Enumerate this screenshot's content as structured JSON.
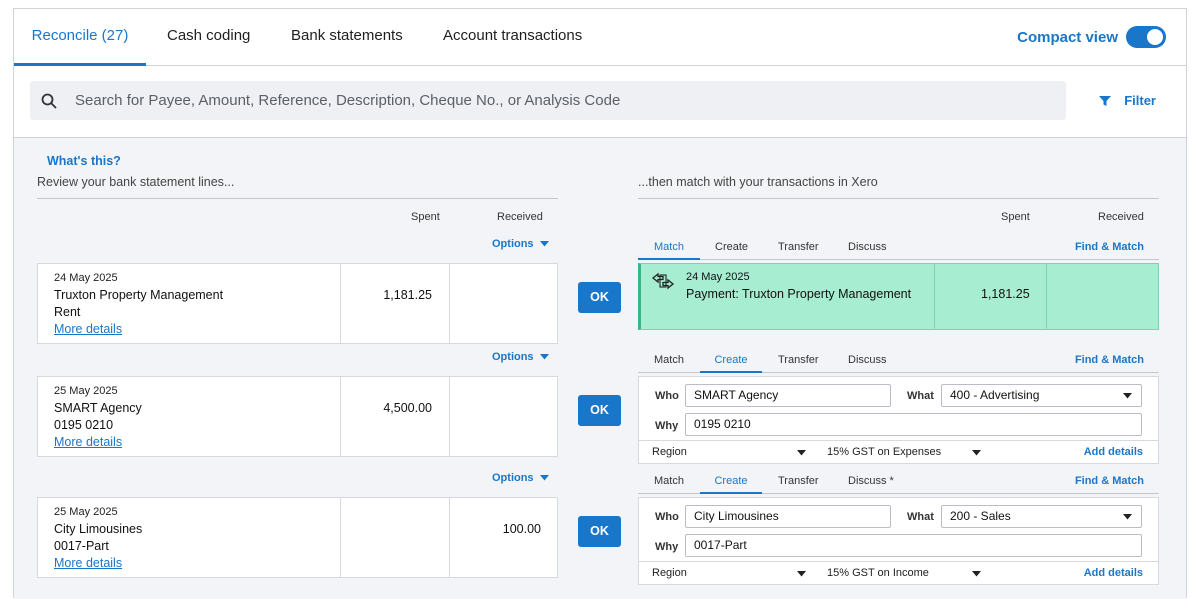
{
  "tabs": [
    {
      "label": "Reconcile (27)",
      "active": true
    },
    {
      "label": "Cash coding",
      "active": false
    },
    {
      "label": "Bank statements",
      "active": false
    },
    {
      "label": "Account transactions",
      "active": false
    }
  ],
  "compact_view": {
    "label": "Compact view",
    "enabled": true
  },
  "search": {
    "placeholder": "Search for Payee, Amount, Reference, Description, Cheque No., or Analysis Code",
    "value": ""
  },
  "filter_label": "Filter",
  "left_header": {
    "whats_this": "What's this?",
    "review": "Review your bank statement lines...",
    "spent": "Spent",
    "received": "Received"
  },
  "right_header": {
    "then": "...then match with your transactions in Xero",
    "spent": "Spent",
    "received": "Received"
  },
  "options_label": "Options",
  "ok_label": "OK",
  "more_details_label": "More details",
  "find_match_label": "Find & Match",
  "add_details_label": "Add details",
  "labels": {
    "who": "Who",
    "what": "What",
    "why": "Why",
    "region": "Region"
  },
  "right_tabs": [
    "Match",
    "Create",
    "Transfer",
    "Discuss"
  ],
  "right_tab_discuss_flagged": "Discuss *",
  "statement_lines": [
    {
      "date": "24 May 2025",
      "payee": "Truxton Property Management",
      "ref": "Rent",
      "spent": "1,181.25",
      "received": ""
    },
    {
      "date": "25 May 2025",
      "payee": "SMART Agency",
      "ref": "0195 0210",
      "spent": "4,500.00",
      "received": ""
    },
    {
      "date": "25 May 2025",
      "payee": "City Limousines",
      "ref": "0017-Part",
      "spent": "",
      "received": "100.00"
    }
  ],
  "match": {
    "date": "24 May 2025",
    "description": "Payment: Truxton Property Management",
    "spent": "1,181.25",
    "received": ""
  },
  "create_1": {
    "who": "SMART Agency",
    "what": "400 - Advertising",
    "why": "0195 0210",
    "region": "",
    "tax": "15% GST on Expenses"
  },
  "create_2": {
    "who": "City Limousines",
    "what": "200 - Sales",
    "why": "0017-Part",
    "region": "",
    "tax": "15% GST on Income"
  },
  "colors": {
    "accent": "#1a76c8",
    "match_bg": "#a7edd2",
    "panel_bg": "#f2f4f7"
  }
}
